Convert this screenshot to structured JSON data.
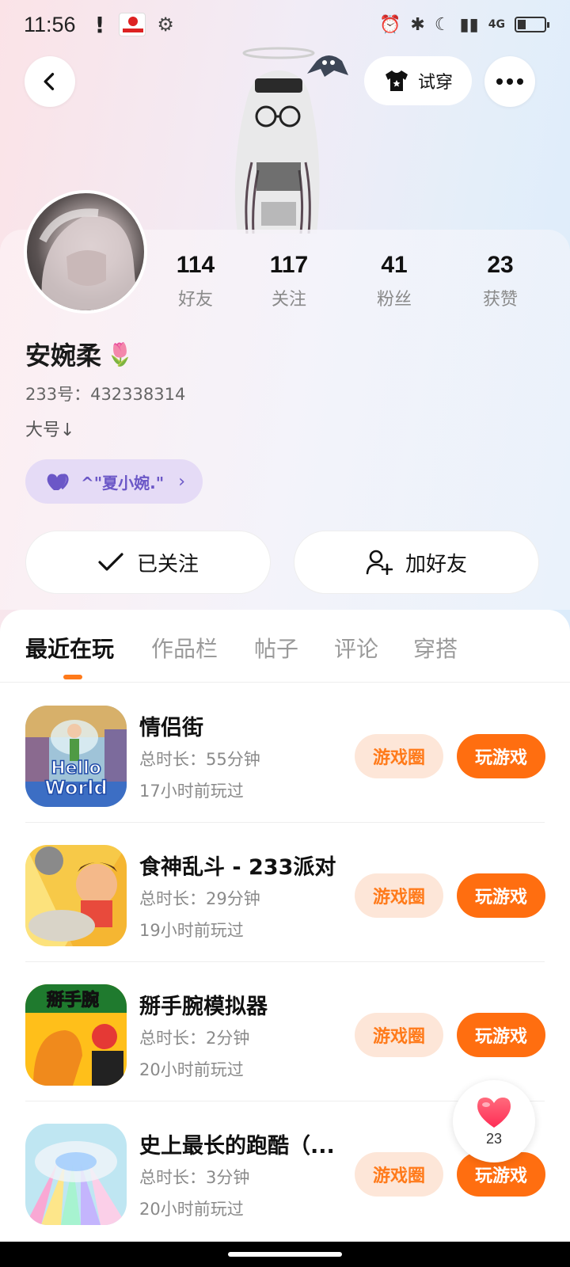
{
  "status_bar": {
    "time": "11:56",
    "alert": "!",
    "network": "4G",
    "icons": [
      "alarm-icon",
      "bluetooth-icon",
      "moon-icon",
      "signal-icon",
      "battery-icon"
    ]
  },
  "header": {
    "tryon_label": "试穿",
    "back_icon": "back-arrow-icon",
    "more_icon": "more-dots-icon"
  },
  "profile": {
    "stats": [
      {
        "value": "114",
        "label": "好友"
      },
      {
        "value": "117",
        "label": "关注"
      },
      {
        "value": "41",
        "label": "粉丝"
      },
      {
        "value": "23",
        "label": "获赞"
      }
    ],
    "name": "安婉柔",
    "name_emoji": "🌷",
    "uid": "233号：432338314",
    "bio": "大号↓",
    "cp_tag": "^\"夏小婉.\""
  },
  "actions": {
    "follow_label": "已关注",
    "add_friend_label": "加好友"
  },
  "tabs": [
    "最近在玩",
    "作品栏",
    "帖子",
    "评论",
    "穿搭"
  ],
  "games": [
    {
      "title": "情侣街",
      "duration": "总时长：55分钟",
      "last_played": "17小时前玩过",
      "circle_label": "游戏圈",
      "play_label": "玩游戏",
      "icon_text": "Hello World"
    },
    {
      "title": "食神乱斗 - 233派对",
      "duration": "总时长：29分钟",
      "last_played": "19小时前玩过",
      "circle_label": "游戏圈",
      "play_label": "玩游戏",
      "icon_text": ""
    },
    {
      "title": "掰手腕模拟器",
      "duration": "总时长：2分钟",
      "last_played": "20小时前玩过",
      "circle_label": "游戏圈",
      "play_label": "玩游戏",
      "icon_text": "掰手腕"
    },
    {
      "title": "史上最长的跑酷（...",
      "duration": "总时长：3分钟",
      "last_played": "20小时前玩过",
      "circle_label": "游戏圈",
      "play_label": "玩游戏",
      "icon_text": ""
    }
  ],
  "like_button": {
    "count": "23"
  },
  "colors": {
    "accent": "#ff6e10",
    "accent_soft": "#fde6d8",
    "cp_tag_bg": "#e5dbf6",
    "cp_tag_fg": "#6b57c7"
  }
}
